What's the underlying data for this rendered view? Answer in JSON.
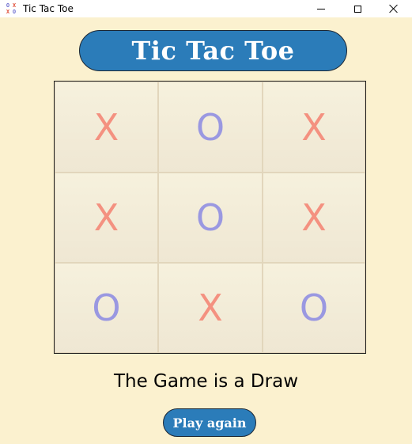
{
  "window": {
    "title": "Tic Tac Toe",
    "icon_glyphs": [
      "O",
      "X",
      "X",
      "O"
    ]
  },
  "header": {
    "title": "Tic Tac Toe"
  },
  "board": {
    "cells": [
      "X",
      "O",
      "X",
      "X",
      "O",
      "X",
      "O",
      "X",
      "O"
    ]
  },
  "status": {
    "message": "The Game is a Draw"
  },
  "play_again": {
    "label": "Play again"
  },
  "colors": {
    "background": "#fbf1cf",
    "accent": "#2b7cb9",
    "x_mark": "#f49180",
    "o_mark": "#9a98e1"
  }
}
